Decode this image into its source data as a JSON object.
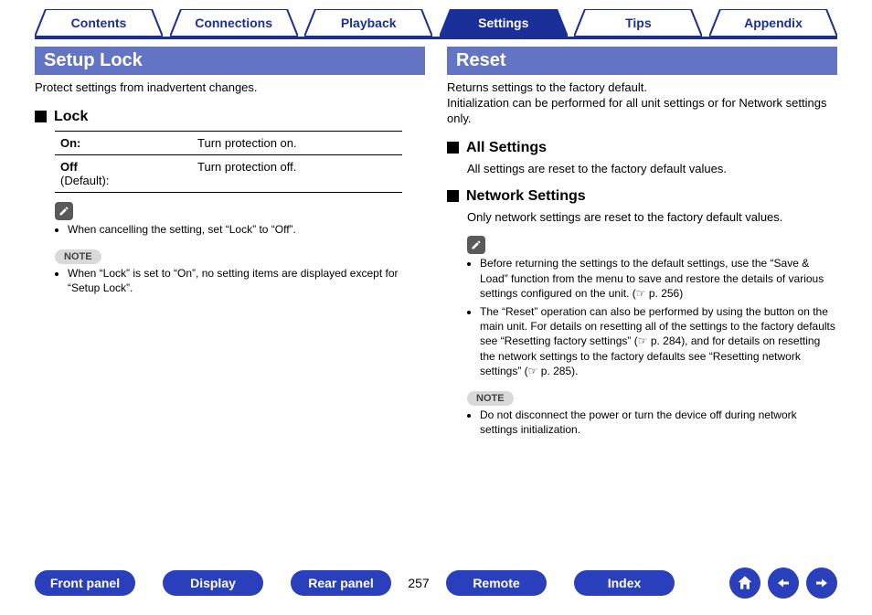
{
  "tabs": {
    "contents": "Contents",
    "connections": "Connections",
    "playback": "Playback",
    "settings": "Settings",
    "tips": "Tips",
    "appendix": "Appendix",
    "active": "settings"
  },
  "left": {
    "title": "Setup Lock",
    "intro": "Protect settings from inadvertent changes.",
    "sub_lock": "Lock",
    "options": [
      {
        "name": "On:",
        "default": "",
        "desc": "Turn protection on."
      },
      {
        "name": "Off",
        "default": "(Default):",
        "desc": "Turn protection off."
      }
    ],
    "tip1": "When cancelling the setting, set “Lock” to “Off”.",
    "note_label": "NOTE",
    "note1": "When “Lock” is set to “On”, no setting items are displayed except for “Setup Lock”."
  },
  "right": {
    "title": "Reset",
    "intro": "Returns settings to the factory default.\nInitialization can be performed for all unit settings or for Network settings only.",
    "sub_all": "All Settings",
    "all_desc": "All settings are reset to the factory default values.",
    "sub_net": "Network Settings",
    "net_desc": "Only network settings are reset to the factory default values.",
    "tip1": "Before returning the settings to the default settings, use the “Save & Load” function from the menu to save and restore the details of various settings configured on the unit. (☞ p. 256)",
    "tip2": "The “Reset” operation can also be performed by using the button on the main unit. For details on resetting all of the settings to the factory defaults see “Resetting factory settings” (☞ p. 284), and for details on resetting the network settings to the factory defaults see “Resetting network settings” (☞ p. 285).",
    "note_label": "NOTE",
    "note1": "Do not disconnect the power or turn the device off during network settings initialization."
  },
  "bottom": {
    "front_panel": "Front panel",
    "display": "Display",
    "rear_panel": "Rear panel",
    "page": "257",
    "remote": "Remote",
    "index": "Index"
  }
}
